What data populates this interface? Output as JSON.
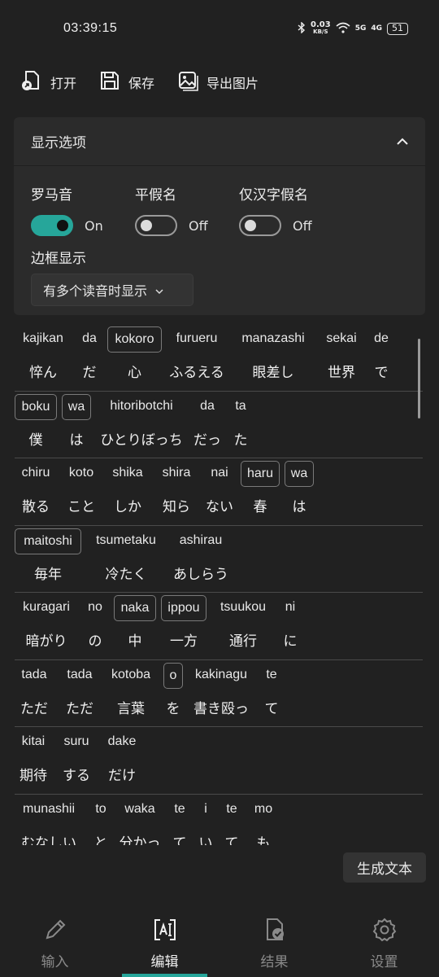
{
  "status": {
    "time": "03:39:15",
    "net_speed": "0.03",
    "net_unit": "KB/S",
    "sig1": "5G",
    "sig2": "4G",
    "battery": "51"
  },
  "toolbar": {
    "open": "打开",
    "save": "保存",
    "export": "导出图片"
  },
  "options": {
    "title": "显示选项",
    "romaji_label": "罗马音",
    "romaji_state": "On",
    "hiragana_label": "平假名",
    "hiragana_state": "Off",
    "kanji_label": "仅汉字假名",
    "kanji_state": "Off",
    "border_label": "边框显示",
    "border_value": "有多个读音时显示"
  },
  "lines": [
    {
      "words": [
        [
          "kajikan",
          "悴ん"
        ],
        [
          "da",
          "だ"
        ],
        [
          "kokoro",
          "心"
        ],
        [
          "furueru",
          "ふるえる"
        ],
        [
          "manazashi",
          "眼差し"
        ],
        [
          "sekai",
          "世界"
        ],
        [
          "de",
          "で"
        ]
      ]
    },
    {
      "words": [
        [
          "boku",
          "僕"
        ],
        [
          "wa",
          "は"
        ],
        [
          "hitoribotchi",
          "ひとりぼっち"
        ],
        [
          "da",
          "だっ"
        ],
        [
          "ta",
          "た"
        ]
      ]
    },
    {
      "words": [
        [
          "chiru",
          "散る"
        ],
        [
          "koto",
          "こと"
        ],
        [
          "shika",
          "しか"
        ],
        [
          "shira",
          "知ら"
        ],
        [
          "nai",
          "ない"
        ],
        [
          "haru",
          "春"
        ],
        [
          "wa",
          "は"
        ]
      ]
    },
    {
      "words": [
        [
          "maitoshi",
          "毎年"
        ],
        [
          "tsumetaku",
          "冷たく"
        ],
        [
          "ashirau",
          "あしらう"
        ]
      ]
    },
    {
      "words": [
        [
          "kuragari",
          "暗がり"
        ],
        [
          "no",
          "の"
        ],
        [
          "naka",
          "中"
        ],
        [
          "ippou",
          "一方"
        ],
        [
          "tsuukou",
          "通行"
        ],
        [
          "ni",
          "に"
        ]
      ]
    },
    {
      "words": [
        [
          "tada",
          "ただ"
        ],
        [
          "tada",
          "ただ"
        ],
        [
          "kotoba",
          "言葉"
        ],
        [
          "o",
          "を"
        ],
        [
          "kakinagu",
          "書き殴っ"
        ],
        [
          "te",
          "て"
        ]
      ]
    },
    {
      "words": [
        [
          "kitai",
          "期待"
        ],
        [
          "suru",
          "する"
        ],
        [
          "dake",
          "だけ"
        ]
      ]
    },
    {
      "words": [
        [
          "munashii",
          "むなしい"
        ],
        [
          "to",
          "と"
        ],
        [
          "waka",
          "分かっ"
        ],
        [
          "te",
          "て"
        ],
        [
          "i",
          "い"
        ],
        [
          "te",
          "て"
        ],
        [
          "mo",
          "も"
        ]
      ]
    }
  ],
  "generate_button": "生成文本",
  "nav": {
    "input": "输入",
    "edit": "编辑",
    "result": "结果",
    "settings": "设置"
  }
}
